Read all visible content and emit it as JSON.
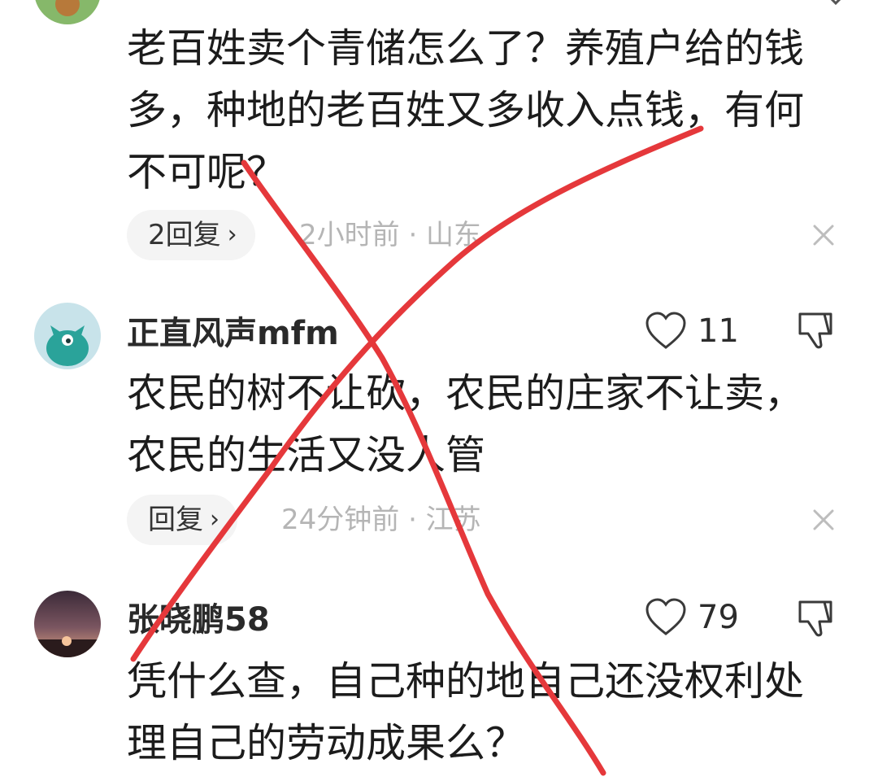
{
  "comments": [
    {
      "username": "",
      "text": "老百姓卖个青储怎么了？养殖户给的钱多，种地的老百姓又多收入点钱，有何不可呢？",
      "reply_label": "2回复",
      "meta": "2小时前 · 山东",
      "likes": ""
    },
    {
      "username": "正直风声mfm",
      "text": "农民的树不让砍，农民的庄家不让卖，农民的生活又没人管",
      "reply_label": "回复",
      "meta": "24分钟前 · 江苏",
      "likes": "11"
    },
    {
      "username": "张晓鹏58",
      "text": "凭什么查，自己种的地自己还没权利处理自己的劳动成果么？",
      "reply_label": "",
      "meta": "",
      "likes": "79"
    }
  ],
  "colors": {
    "annotation_red": "#e5383b",
    "meta_gray": "#b5b5b5",
    "pill_bg": "#f4f4f4"
  },
  "icons": {
    "like": "heart-outline-icon",
    "dislike": "thumbs-down-icon",
    "close": "close-icon",
    "reply_chevron": "chevron-right-icon"
  }
}
